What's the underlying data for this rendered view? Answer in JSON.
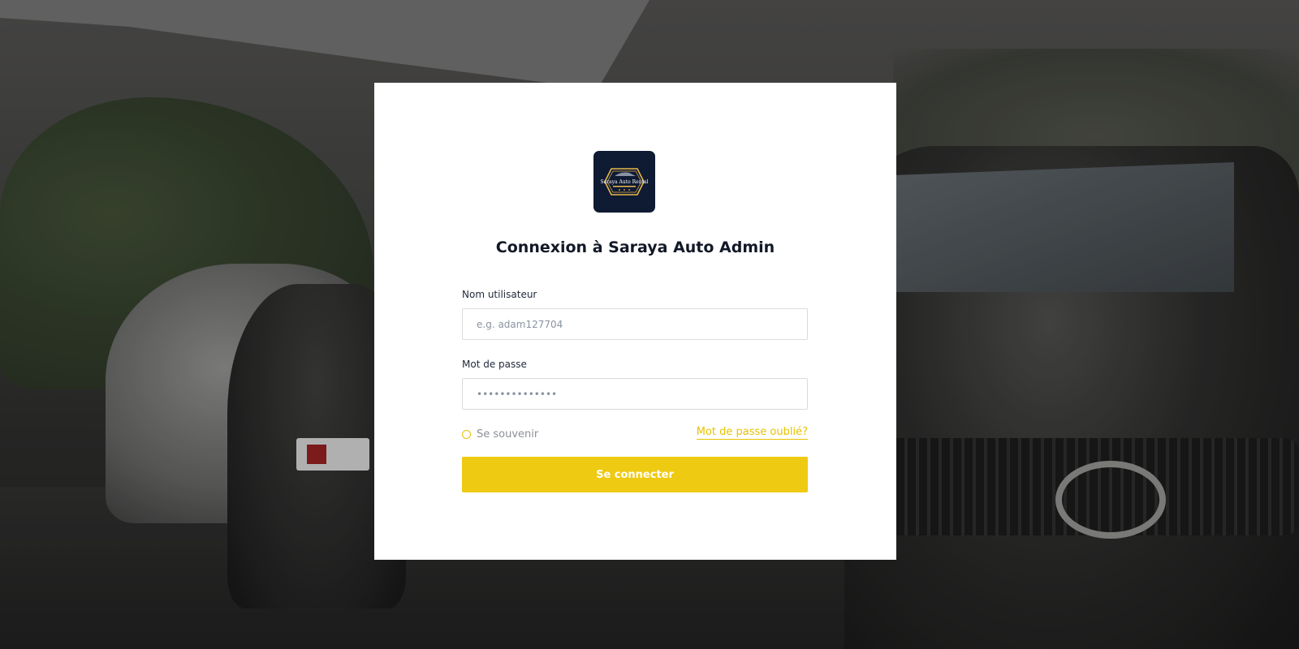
{
  "logo": {
    "text": "Saraya Auto Rental",
    "icon": "saraya-car-logo-icon",
    "bg_color": "#0f1a33",
    "accent_color": "#e8b84a"
  },
  "login": {
    "title": "Connexion à Saraya Auto Admin",
    "username_label": "Nom utilisateur",
    "username_placeholder": "e.g. adam127704",
    "username_value": "",
    "password_label": "Mot de passe",
    "password_placeholder": "••••••••••••••",
    "password_value": "",
    "remember_label": "Se souvenir",
    "remember_checked": false,
    "forgot_label": "Mot de passe oublié?",
    "submit_label": "Se connecter"
  },
  "colors": {
    "accent": "#efca12",
    "title": "#111827",
    "card_bg": "#ffffff"
  }
}
